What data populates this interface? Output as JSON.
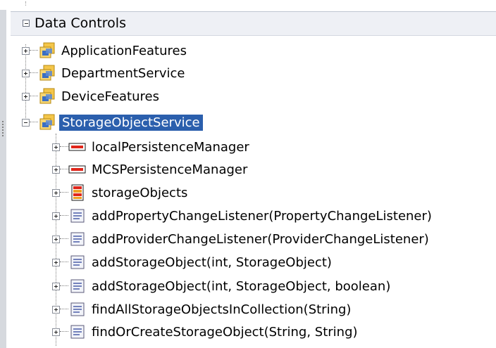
{
  "section": {
    "title": "Data Controls"
  },
  "tree": [
    {
      "label": "ApplicationFeatures",
      "icon": "data-control-icon",
      "state": "collapsed"
    },
    {
      "label": "DepartmentService",
      "icon": "data-control-icon",
      "state": "collapsed"
    },
    {
      "label": "DeviceFeatures",
      "icon": "data-control-icon",
      "state": "collapsed"
    },
    {
      "label": "StorageObjectService",
      "icon": "data-control-icon",
      "state": "expanded",
      "selected": true,
      "children": [
        {
          "label": "localPersistenceManager",
          "icon": "object-attribute-icon"
        },
        {
          "label": "MCSPersistenceManager",
          "icon": "object-attribute-icon"
        },
        {
          "label": "storageObjects",
          "icon": "collection-icon"
        },
        {
          "label": "addPropertyChangeListener(PropertyChangeListener)",
          "icon": "method-icon"
        },
        {
          "label": "addProviderChangeListener(ProviderChangeListener)",
          "icon": "method-icon"
        },
        {
          "label": "addStorageObject(int, StorageObject)",
          "icon": "method-icon"
        },
        {
          "label": "addStorageObject(int, StorageObject, boolean)",
          "icon": "method-icon"
        },
        {
          "label": "findAllStorageObjectsInCollection(String)",
          "icon": "method-icon"
        },
        {
          "label": "findOrCreateStorageObject(String, String)",
          "icon": "method-icon"
        }
      ]
    }
  ]
}
